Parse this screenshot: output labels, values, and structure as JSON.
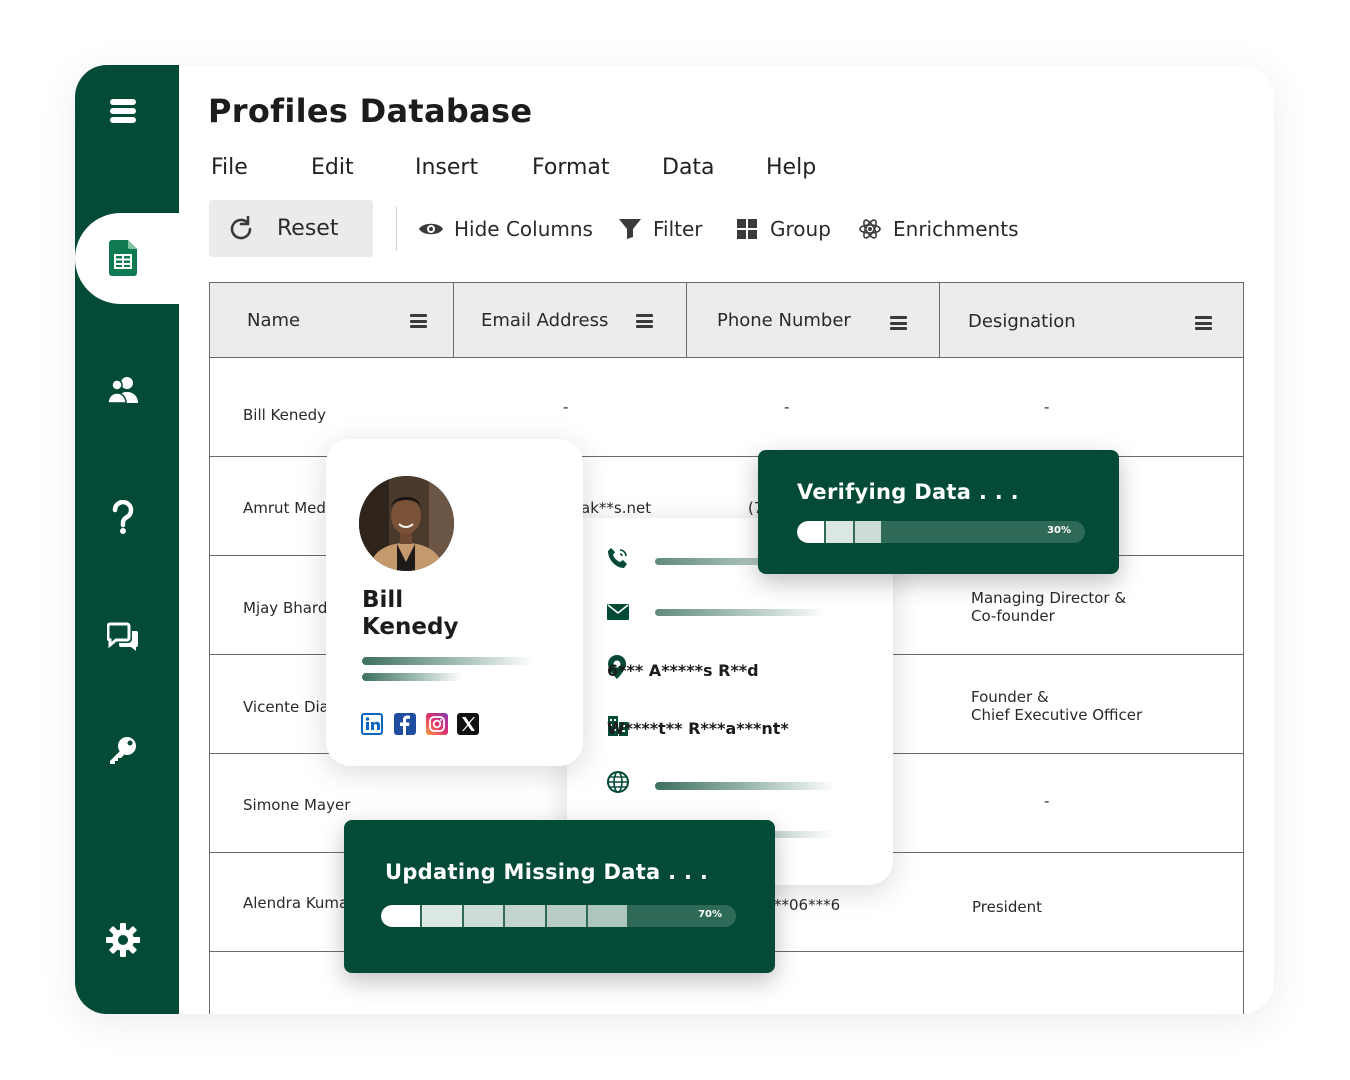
{
  "app": {
    "title": "Profiles Database"
  },
  "menu": [
    "File",
    "Edit",
    "Insert",
    "Format",
    "Data",
    "Help"
  ],
  "toolbar": {
    "reset_label": "Reset",
    "hide_columns_label": "Hide Columns",
    "filter_label": "Filter",
    "group_label": "Group",
    "enrichments_label": "Enrichments"
  },
  "sidebar": {
    "items": [
      {
        "icon": "database-icon"
      },
      {
        "icon": "spreadsheet-icon",
        "active": true
      },
      {
        "icon": "users-icon"
      },
      {
        "icon": "help-icon"
      },
      {
        "icon": "chat-icon"
      },
      {
        "icon": "key-icon"
      },
      {
        "icon": "gear-icon"
      }
    ]
  },
  "table": {
    "columns": [
      "Name",
      "Email Address",
      "Phone Number",
      "Designation"
    ],
    "rows": [
      {
        "name": "Bill Kenedy",
        "email": "-",
        "phone": "-",
        "designation": "-"
      },
      {
        "name": "Amrut Med",
        "email": "ak**s.net",
        "phone": "(7",
        "designation": ""
      },
      {
        "name": "Mjay Bhard",
        "email": "",
        "phone": "",
        "designation_line1": "Managing Director &",
        "designation_line2": "Co-founder"
      },
      {
        "name": "Vicente Dia",
        "email": "",
        "phone": "",
        "designation_line1": "Founder &",
        "designation_line2": "Chief Executive Officer"
      },
      {
        "name": "Simone Mayer",
        "email": "",
        "phone": "",
        "designation": "-"
      },
      {
        "name": "Alendra Kuma",
        "email": "",
        "phone": "**06***6",
        "designation": "President"
      }
    ]
  },
  "profile_card": {
    "first_name": "Bill",
    "last_name": "Kenedy",
    "socials": [
      "linkedin-icon",
      "facebook-icon",
      "instagram-icon",
      "x-icon"
    ]
  },
  "details_card": {
    "address": "6*** A*****s R**d",
    "company": "W****t** R***a***nt*"
  },
  "verifying": {
    "title": "Verifying Data . . .",
    "percent_label": "30%",
    "progress": 0.3
  },
  "updating": {
    "title": "Updating Missing Data . . .",
    "percent_label": "70%",
    "progress": 0.7
  },
  "colors": {
    "brand": "#034a37",
    "progress_track": "#2f6a58"
  }
}
